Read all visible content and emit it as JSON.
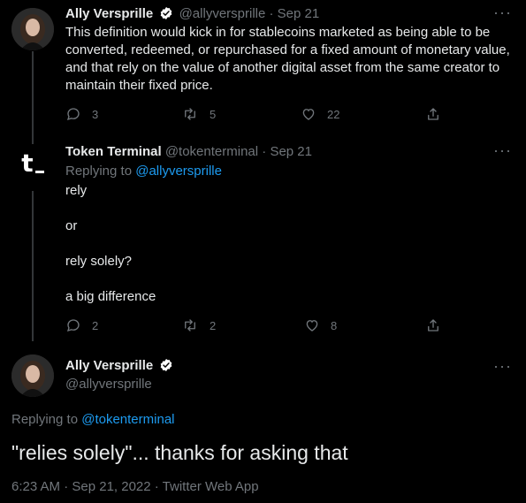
{
  "tweets": [
    {
      "name": "Ally Versprille",
      "handle": "@allyversprille",
      "sep": "·",
      "date": "Sep 21",
      "text": "This definition would kick in for stablecoins marketed as being able to be converted, redeemed, or repurchased for a fixed amount of monetary value, and that rely on the value of another digital asset from the same creator to maintain their fixed price.",
      "replies": "3",
      "retweets": "5",
      "likes": "22"
    },
    {
      "name": "Token Terminal",
      "handle": "@tokenterminal",
      "sep": "·",
      "date": "Sep 21",
      "replying_prefix": "Replying to ",
      "replying_handle": "@allyversprille",
      "lines": [
        "rely",
        "or",
        "rely solely?",
        "a big difference"
      ],
      "replies": "2",
      "retweets": "2",
      "likes": "8"
    }
  ],
  "main_tweet": {
    "name": "Ally Versprille",
    "handle": "@allyversprille",
    "replying_prefix": "Replying to ",
    "replying_handle": "@tokenterminal",
    "text": "\"relies solely\"... thanks for asking that",
    "timestamp": "6:23 AM · Sep 21, 2022 · Twitter Web App"
  },
  "avatar_initial": "t",
  "colors": {
    "background": "#000000",
    "text": "#e7e9ea",
    "muted": "#71767b",
    "accent": "#1d9bf0",
    "verified": "#ffffff"
  },
  "icons": [
    "reply-icon",
    "retweet-icon",
    "like-icon",
    "share-icon",
    "more-icon",
    "verified-icon"
  ]
}
